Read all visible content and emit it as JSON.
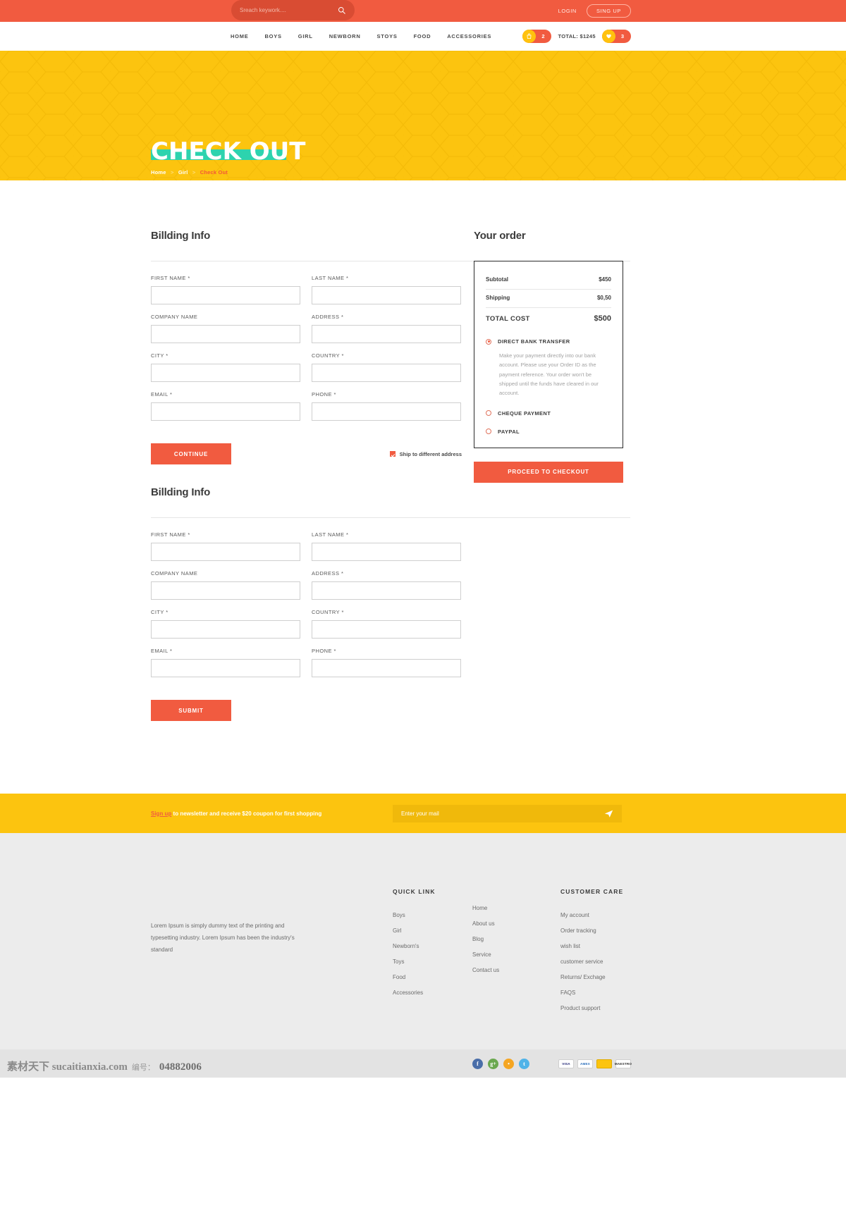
{
  "topbar": {
    "search_placeholder": "Sreach keywork....",
    "search_value": "",
    "search_icon": "search-icon",
    "login_label": "LOGIN",
    "signup_label": "SING UP"
  },
  "nav": {
    "items": [
      {
        "label": "HOME"
      },
      {
        "label": "BOYS"
      },
      {
        "label": "GIRL"
      },
      {
        "label": "NEWBORN"
      },
      {
        "label": "STOYS"
      },
      {
        "label": "FOOD"
      },
      {
        "label": "ACCESSORIES"
      }
    ],
    "cart": {
      "icon": "bag-icon",
      "count": "2"
    },
    "total_label": "TOTAL: $1245",
    "wishlist": {
      "icon": "heart-icon",
      "count": "3"
    }
  },
  "hero": {
    "title": "CHECK OUT",
    "breadcrumb": [
      {
        "label": "Home",
        "current": false
      },
      {
        "label": "Girl",
        "current": false
      },
      {
        "label": "Check Out",
        "current": true
      }
    ],
    "bg_color": "#fcc40f",
    "band_color": "#2dd3ae"
  },
  "billing": {
    "heading": "Billding Info",
    "fields": [
      {
        "label": "FIRST NAME *",
        "value": "",
        "name": "first-name"
      },
      {
        "label": "LAST NAME *",
        "value": "",
        "name": "last-name"
      },
      {
        "label": "COMPANY NAME",
        "value": "",
        "name": "company-name"
      },
      {
        "label": "ADDRESS *",
        "value": "",
        "name": "address"
      },
      {
        "label": "CITY *",
        "value": "",
        "name": "city"
      },
      {
        "label": "COUNTRY *",
        "value": "",
        "name": "country"
      },
      {
        "label": "EMAIL *",
        "value": "",
        "name": "email"
      },
      {
        "label": "PHONE *",
        "value": "",
        "name": "phone"
      }
    ],
    "continue_label": "CONTINUE",
    "ship_diff_label": "Ship to different address",
    "ship_diff_checked": true
  },
  "shipping": {
    "heading": "Billding Info",
    "fields": [
      {
        "label": "FIRST NAME *",
        "value": "",
        "name": "first-name"
      },
      {
        "label": "LAST NAME *",
        "value": "",
        "name": "last-name"
      },
      {
        "label": "COMPANY NAME",
        "value": "",
        "name": "company-name"
      },
      {
        "label": "ADDRESS *",
        "value": "",
        "name": "address"
      },
      {
        "label": "CITY *",
        "value": "",
        "name": "city"
      },
      {
        "label": "COUNTRY *",
        "value": "",
        "name": "country"
      },
      {
        "label": "EMAIL *",
        "value": "",
        "name": "email"
      },
      {
        "label": "PHONE *",
        "value": "",
        "name": "phone"
      }
    ],
    "submit_label": "SUBMIT"
  },
  "order": {
    "heading": "Your order",
    "rows": [
      {
        "label": "Subtotal",
        "value": "$450"
      },
      {
        "label": "Shipping",
        "value": "$0,50"
      },
      {
        "label": "TOTAL COST",
        "value": "$500"
      }
    ],
    "payments": [
      {
        "name": "DIRECT BANK TRANSFER",
        "selected": true,
        "desc": "Make your payment directly into our bank account. Please use your Order ID as the payment reference. Your order won't be shipped until the funds have cleared in our account."
      },
      {
        "name": "CHEQUE PAYMENT",
        "selected": false,
        "desc": ""
      },
      {
        "name": "PAYPAL",
        "selected": false,
        "desc": ""
      }
    ],
    "checkout_label": "PROCEED TO CHECKOUT",
    "accent": "#f15b40"
  },
  "newsletter": {
    "signup_label": "Sign up",
    "text": " to newsletter and receive $20 coupon for first shopping",
    "input_placeholder": "Enter your mail",
    "input_value": "",
    "send_icon": "paper-plane-icon"
  },
  "footer": {
    "about": "Lorem Ipsum is simply dummy text of the printing and typesetting industry. Lorem Ipsum has been the industry's standard",
    "columns": [
      {
        "head": "QUICK LINK",
        "links": [
          "Boys",
          "Girl",
          "Newborn's",
          "Toys",
          "Food",
          "Accessories"
        ]
      },
      {
        "head": "",
        "links": [
          "Home",
          "About us",
          "Blog",
          "Service",
          "Contact us"
        ]
      },
      {
        "head": "CUSTOMER CARE",
        "links": [
          "My account",
          "Order tracking",
          "wish list",
          "customer service",
          "Returns/ Exchage",
          "FAQS",
          "Product support"
        ]
      }
    ],
    "socials": [
      {
        "name": "facebook-icon",
        "glyph": "f"
      },
      {
        "name": "google-plus-icon",
        "glyph": "g+"
      },
      {
        "name": "rss-icon",
        "glyph": "•"
      },
      {
        "name": "twitter-icon",
        "glyph": "t"
      }
    ],
    "cards": [
      {
        "name": "visa-card-icon",
        "label": "VISA"
      },
      {
        "name": "amex-card-icon",
        "label": "AMEX"
      },
      {
        "name": "mastercard-icon",
        "label": ""
      },
      {
        "name": "maestro-card-icon",
        "label": "MAESTRO"
      }
    ]
  },
  "watermark": {
    "site": "素材天下 sucaitianxia.com",
    "label": "编号：",
    "number": "04882006"
  }
}
